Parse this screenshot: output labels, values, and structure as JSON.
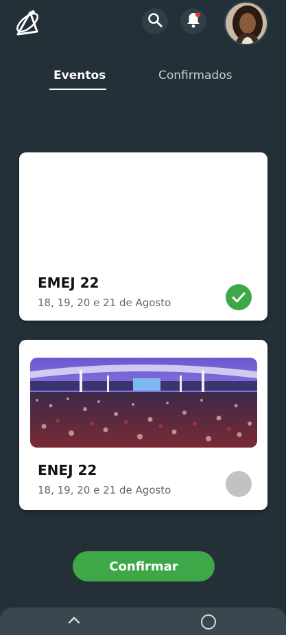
{
  "header": {
    "logo_icon": "app-logo",
    "search_icon": "search-icon",
    "notification_icon": "bell-icon",
    "has_unread_notification": true,
    "avatar": "user-avatar"
  },
  "tabs": [
    {
      "label": "Eventos",
      "active": true
    },
    {
      "label": "Confirmados",
      "active": false
    }
  ],
  "events": [
    {
      "title": "EMEJ 22",
      "date": "18, 19, 20 e 21 de Agosto",
      "selected": true,
      "has_image": false
    },
    {
      "title": "ENEJ 22",
      "date": "18, 19, 20 e 21 de Agosto",
      "selected": false,
      "has_image": true
    }
  ],
  "confirm_button": {
    "label": "Confirmar"
  },
  "colors": {
    "background": "#233038",
    "accent_green": "#3ea748",
    "card": "#ffffff",
    "unselected": "#c2c2c2"
  }
}
